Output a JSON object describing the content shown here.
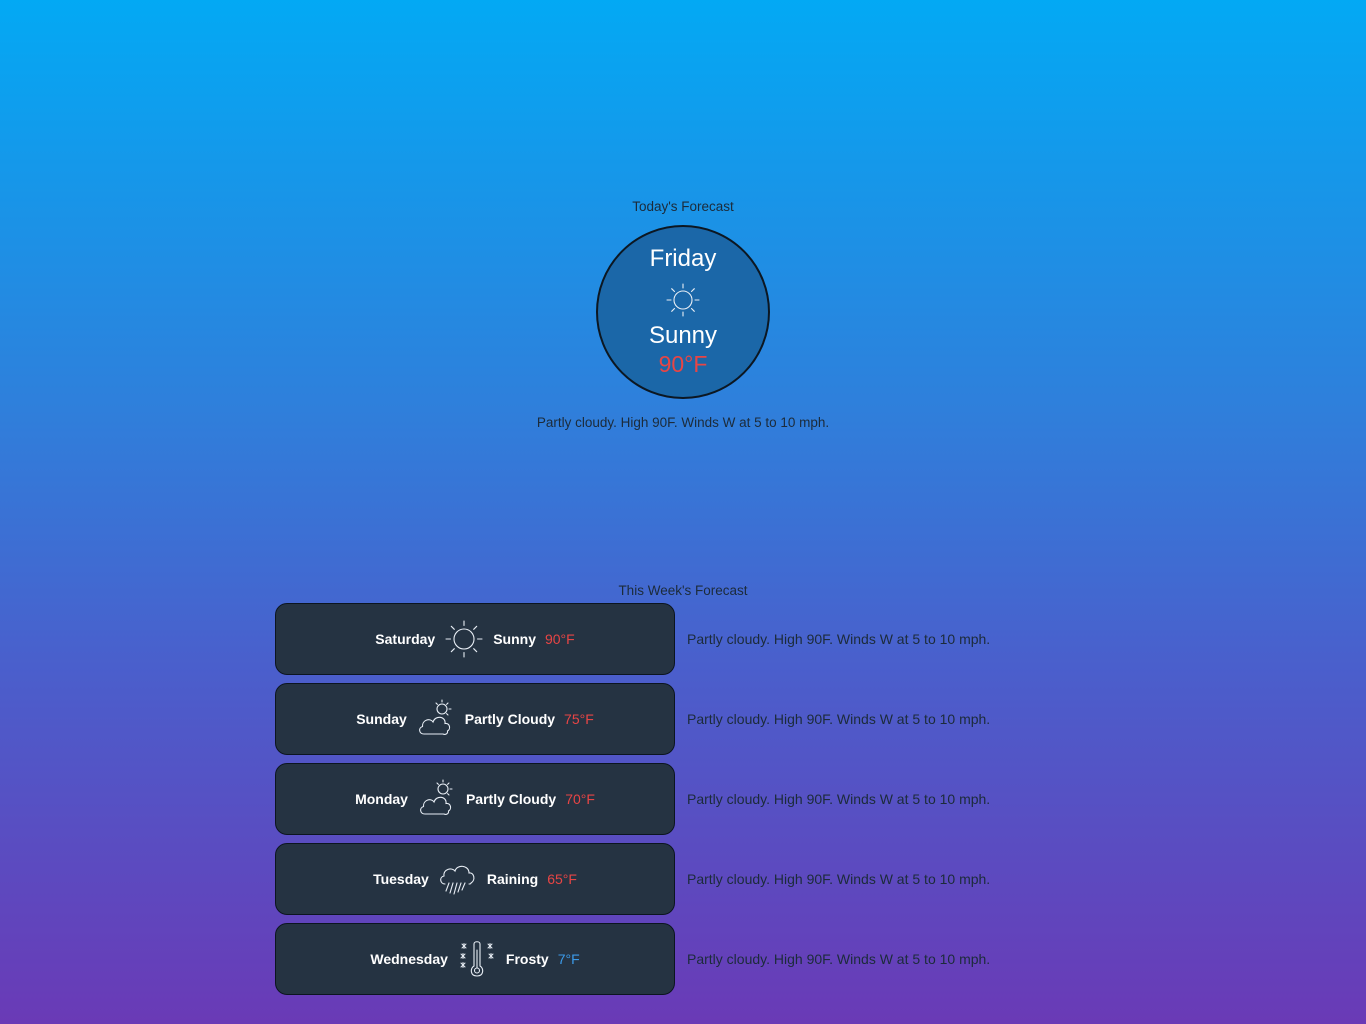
{
  "today": {
    "section_title": "Today's Forecast",
    "day": "Friday",
    "icon": "sun-icon",
    "condition": "Sunny",
    "temperature": "90°F",
    "temp_color": "#e84545",
    "description": "Partly cloudy. High 90F. Winds W at 5 to 10 mph."
  },
  "week": {
    "section_title": "This Week's Forecast",
    "days": [
      {
        "day": "Saturday",
        "icon": "sun-icon",
        "condition": "Sunny",
        "temperature": "90°F",
        "temp_color": "#e84545",
        "description": "Partly cloudy. High 90F. Winds W at 5 to 10 mph."
      },
      {
        "day": "Sunday",
        "icon": "partly-cloudy-icon",
        "condition": "Partly Cloudy",
        "temperature": "75°F",
        "temp_color": "#e84545",
        "description": "Partly cloudy. High 90F. Winds W at 5 to 10 mph."
      },
      {
        "day": "Monday",
        "icon": "partly-cloudy-icon",
        "condition": "Partly Cloudy",
        "temperature": "70°F",
        "temp_color": "#e84545",
        "description": "Partly cloudy. High 90F. Winds W at 5 to 10 mph."
      },
      {
        "day": "Tuesday",
        "icon": "rain-cloud-icon",
        "condition": "Raining",
        "temperature": "65°F",
        "temp_color": "#e84545",
        "description": "Partly cloudy. High 90F. Winds W at 5 to 10 mph."
      },
      {
        "day": "Wednesday",
        "icon": "frost-thermometer-icon",
        "condition": "Frosty",
        "temperature": "7°F",
        "temp_color": "#3b9ae8",
        "description": "Partly cloudy. High 90F. Winds W at 5 to 10 mph."
      }
    ]
  }
}
